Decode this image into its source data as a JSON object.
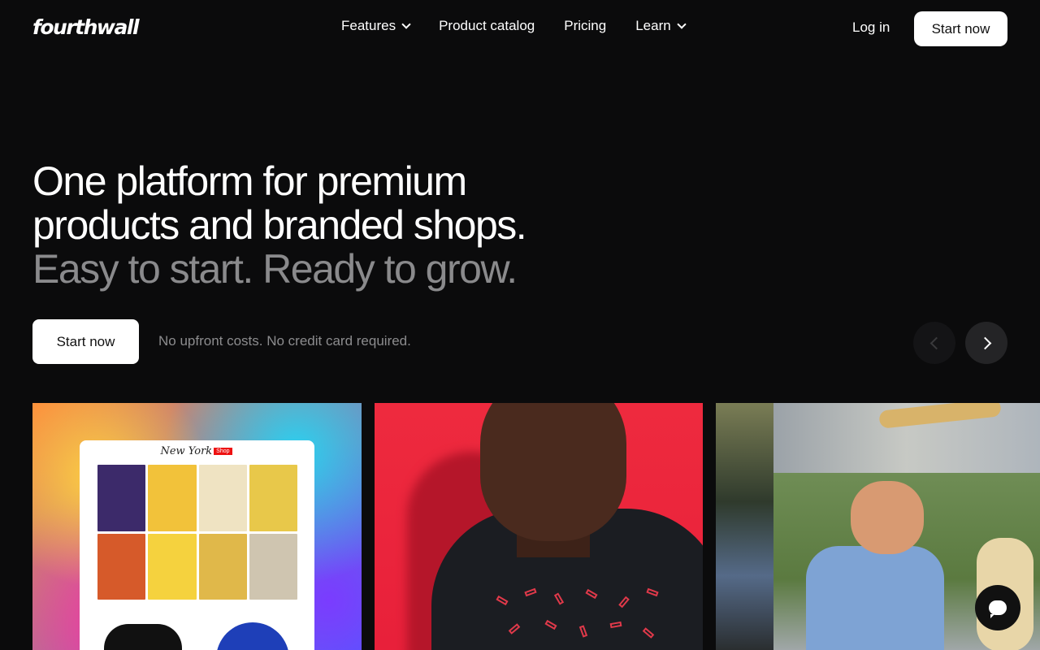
{
  "nav": {
    "logo": "fourthwall",
    "links": [
      {
        "label": "Features",
        "has_dropdown": true
      },
      {
        "label": "Product catalog",
        "has_dropdown": false
      },
      {
        "label": "Pricing",
        "has_dropdown": false
      },
      {
        "label": "Learn",
        "has_dropdown": true
      }
    ],
    "login": "Log in",
    "cta": "Start now"
  },
  "hero": {
    "line1": "One platform for premium",
    "line2": "products and branded shops.",
    "line3": "Easy to start. Ready to grow.",
    "cta": "Start now",
    "note": "No upfront costs. No credit card required."
  },
  "carousel": {
    "prev_icon": "chevron-left-icon",
    "next_icon": "chevron-right-icon",
    "cards": [
      {
        "name": "shop-preview-card",
        "shop_brand": "New York",
        "shop_tag": "Shop"
      },
      {
        "name": "tshirt-model-card"
      },
      {
        "name": "skater-card"
      }
    ]
  },
  "chat": {
    "icon": "chat-bubble-icon"
  },
  "colors": {
    "background": "#0b0b0c",
    "text": "#ffffff",
    "muted": "#8a8a8c",
    "button_bg": "#ffffff"
  }
}
